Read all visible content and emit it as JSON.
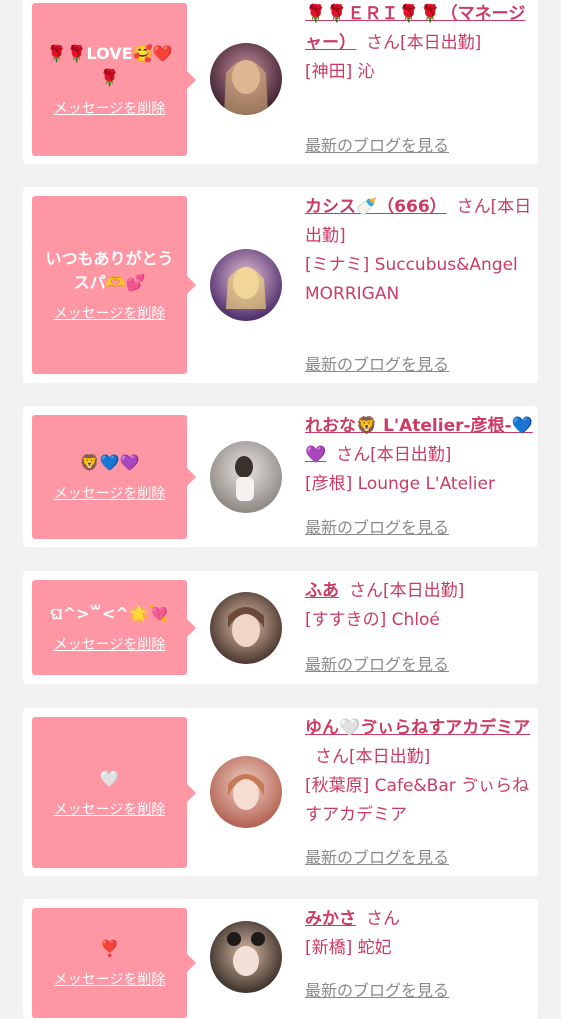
{
  "entries": [
    {
      "message": "🌹🌹LOVE🥰❤️🌹",
      "delete_label": "メッセージを削除",
      "name": "🌹🌹ＥＲＩ🌹🌹（マネージャー）",
      "honorific": "さん",
      "status": "[本日出勤]",
      "shop": "[神田] 沁",
      "blog_label": "最新のブログを見る",
      "avatar_colors": [
        "#3b1f2e",
        "#c98fa0"
      ]
    },
    {
      "message": "いつもありがとうスパ🫶💕",
      "delete_label": "メッセージを削除",
      "name": "カシス🍼（666）",
      "honorific": "さん",
      "status": "[本日出勤]",
      "shop": "[ミナミ] Succubus&Angel MORRIGAN",
      "blog_label": "最新のブログを見る",
      "avatar_colors": [
        "#4a2a6a",
        "#e9c3d6"
      ]
    },
    {
      "message": "🦁💙💜",
      "delete_label": "メッセージを削除",
      "name": "れおな🦁 L'Atelier-彦根-💙💜",
      "honorific": "さん",
      "status": "[本日出勤]",
      "shop": "[彦根] Lounge L'Atelier",
      "blog_label": "最新のブログを見る",
      "avatar_colors": [
        "#d9d6d3",
        "#8d8782"
      ]
    },
    {
      "message": "ଘ^>꒳<^🌟💘",
      "delete_label": "メッセージを削除",
      "name": "ふあ",
      "honorific": "さん",
      "status": "[本日出勤]",
      "shop": "[すすきの] Chloé",
      "blog_label": "最新のブログを見る",
      "avatar_colors": [
        "#3a2a22",
        "#e8c4b0"
      ]
    },
    {
      "message": "🤍",
      "delete_label": "メッセージを削除",
      "name": "ゆん🤍ゔぃらねすアカデミア",
      "honorific": "さん",
      "status": "[本日出勤]",
      "shop": "[秋葉原] Cafe&Bar ゔぃらねすアカデミア",
      "blog_label": "最新のブログを見る",
      "avatar_colors": [
        "#f3d0c8",
        "#b0614f"
      ]
    },
    {
      "message": "❣️",
      "delete_label": "メッセージを削除",
      "name": "みかさ",
      "honorific": "さん",
      "status": "",
      "shop": "[新橋] 蛇妃",
      "blog_label": "最新のブログを見る",
      "avatar_colors": [
        "#2e2620",
        "#d9b9a5"
      ]
    }
  ]
}
